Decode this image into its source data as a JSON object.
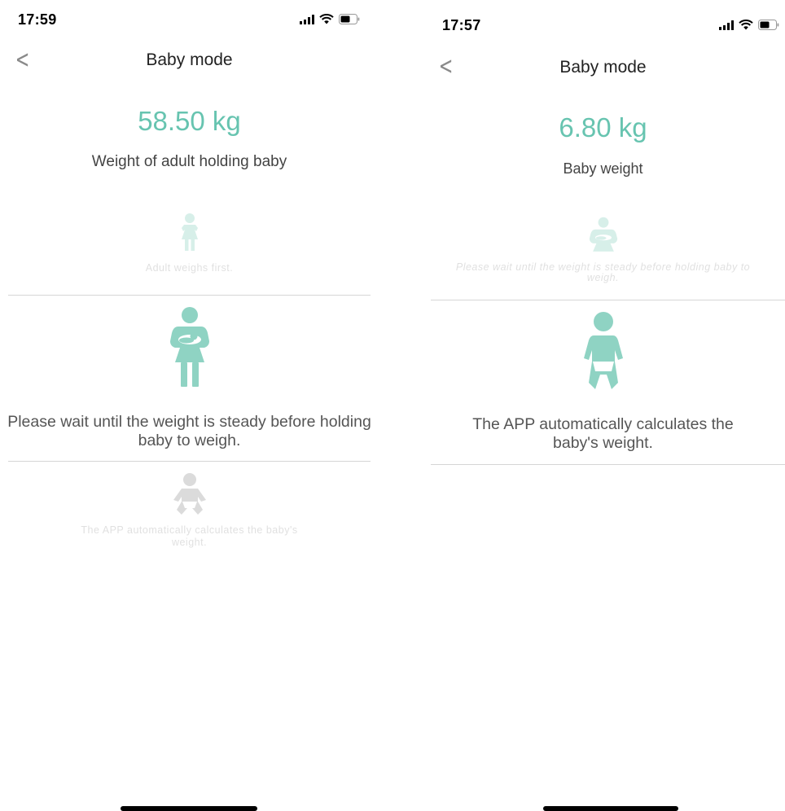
{
  "colors": {
    "accent": "#67c4b0",
    "icon_teal": "#8fd3c3",
    "icon_gray": "#b8b8b8"
  },
  "left": {
    "status_time": "17:59",
    "title": "Baby mode",
    "weight": "58.50 kg",
    "caption": "Weight of adult holding baby",
    "steps": [
      {
        "icon": "adult-woman-icon",
        "text": "Adult weighs first."
      },
      {
        "icon": "adult-holding-baby-icon",
        "text": "Please wait until the weight is steady before holding baby to weigh."
      },
      {
        "icon": "baby-icon",
        "text": "The APP automatically calculates the baby's weight."
      }
    ]
  },
  "right": {
    "status_time": "17:57",
    "title": "Baby mode",
    "weight": "6.80 kg",
    "caption": "Baby weight",
    "steps": [
      {
        "icon": "adult-holding-baby-icon",
        "text": "Please wait until the weight is steady before holding baby to weigh."
      },
      {
        "icon": "baby-icon",
        "text": "The APP automatically calculates the baby's weight."
      }
    ]
  }
}
